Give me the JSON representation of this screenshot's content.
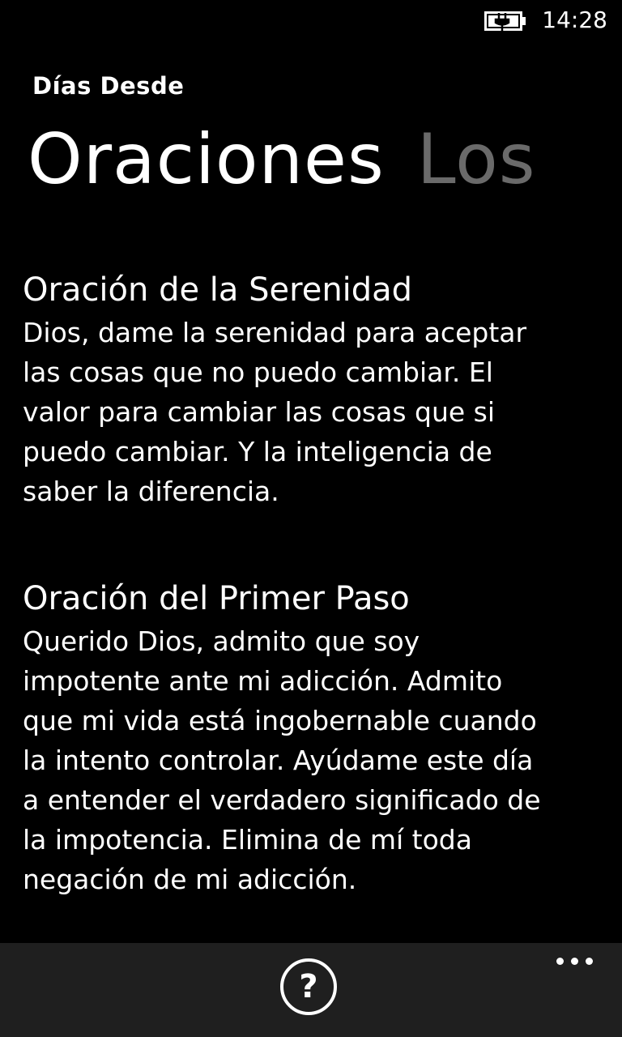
{
  "status_bar": {
    "time": "14:28",
    "battery_icon": "battery-charging-icon"
  },
  "app": {
    "title": "Días Desde"
  },
  "pivot": {
    "items": [
      "Oraciones",
      "Los"
    ]
  },
  "prayers": [
    {
      "title": "Oración de la Serenidad",
      "lines": [
        "Dios, dame la serenidad para aceptar",
        "las cosas que no puedo cambiar. El",
        "valor para cambiar las cosas que si",
        "puedo cambiar. Y la inteligencia de",
        "saber la diferencia."
      ]
    },
    {
      "title": "Oración del Primer Paso",
      "lines": [
        "Querido Dios, admito que soy",
        "impotente ante mi adicción. Admito",
        "que mi vida está ingobernable cuando",
        "la intento controlar. Ayúdame este día",
        "a entender el verdadero significado de",
        "la impotencia. Elimina de mí toda",
        "negación de mi adicción."
      ]
    }
  ],
  "app_bar": {
    "help_icon": "help-icon",
    "help_glyph": "?",
    "more_icon": "more-icon"
  },
  "colors": {
    "background": "#000000",
    "text": "#ffffff",
    "inactive_pivot": "#6a6a6a",
    "app_bar": "#1f1f1f"
  }
}
